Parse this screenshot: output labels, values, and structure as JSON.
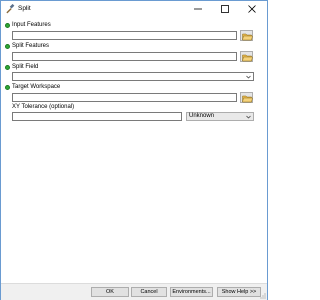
{
  "window": {
    "title": "Split",
    "app_icon": "hammer-icon"
  },
  "controls": {
    "minimize": "minimize-icon",
    "maximize": "maximize-icon",
    "close": "close-icon"
  },
  "params": {
    "input_features": {
      "label": "Input Features",
      "value": ""
    },
    "split_features": {
      "label": "Split Features",
      "value": ""
    },
    "split_field": {
      "label": "Split Field",
      "value": ""
    },
    "target_workspace": {
      "label": "Target Workspace",
      "value": ""
    },
    "xy_tolerance": {
      "label": "XY Tolerance (optional)",
      "value": "",
      "unit": "Unknown"
    }
  },
  "buttons": {
    "ok": "OK",
    "cancel": "Cancel",
    "environments": "Environments...",
    "show_help": "Show Help >>"
  },
  "colors": {
    "required_dot": "#2fa936",
    "folder": "#e8b84a",
    "accent_border": "#6a9bd1"
  }
}
